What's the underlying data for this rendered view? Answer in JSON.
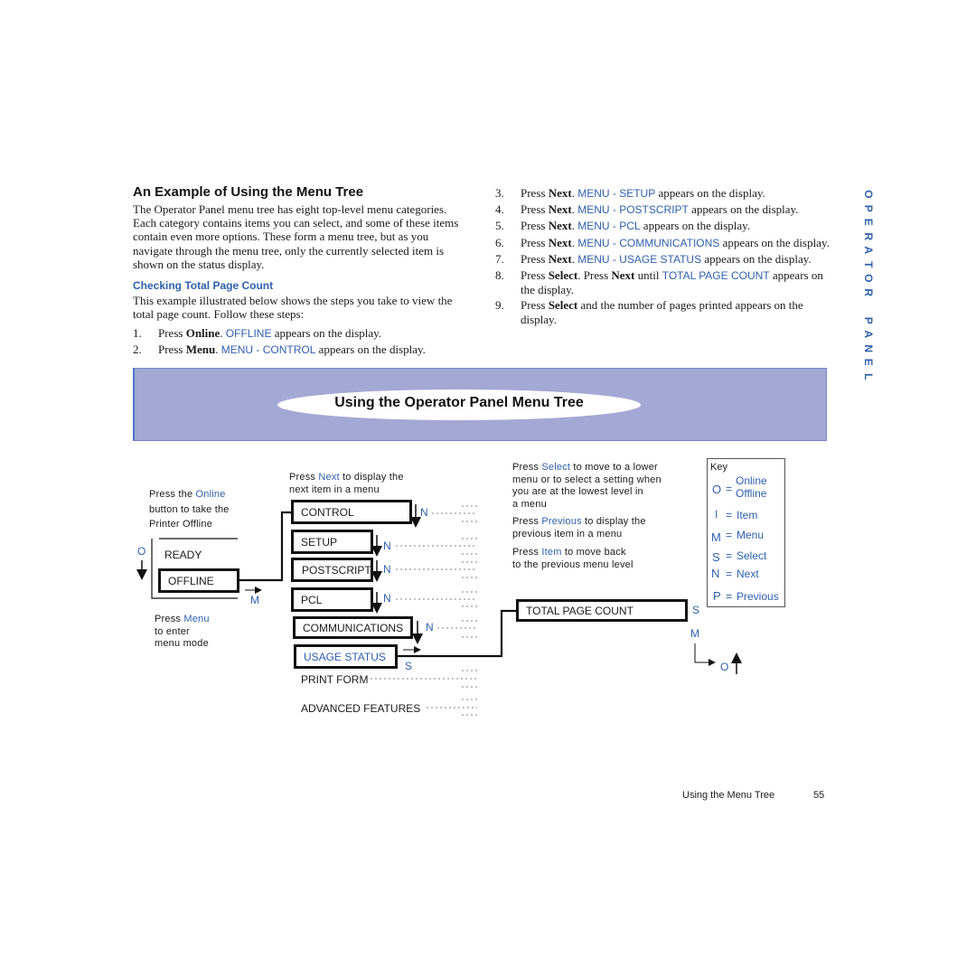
{
  "section": {
    "title": "An Example of Using the Menu Tree",
    "intro": "The Operator Panel menu tree has eight top-level menu categories. Each category contains items you can select, and some of these items contain even more options. These form a menu tree, but as you navigate through the menu tree, only the currently selected item is shown on the status display.",
    "subheading": "Checking Total Page Count",
    "subintro": "This example illustrated below shows the steps you take to view the total page count. Follow these steps:"
  },
  "steps": [
    {
      "num": "1.",
      "pre": "Press ",
      "key": "Online",
      "mid": ". ",
      "display": "OFFLINE",
      "post": " appears on the display."
    },
    {
      "num": "2.",
      "pre": "Press ",
      "key": "Menu",
      "mid": ". ",
      "display": "MENU - CONTROL",
      "post": " appears on the display."
    },
    {
      "num": "3.",
      "pre": "Press ",
      "key": "Next",
      "mid": ". ",
      "display": "MENU - SETUP",
      "post": " appears on the display."
    },
    {
      "num": "4.",
      "pre": "Press ",
      "key": "Next",
      "mid": ". ",
      "display": "MENU - POSTSCRIPT",
      "post": " appears on the display."
    },
    {
      "num": "5.",
      "pre": "Press ",
      "key": "Next",
      "mid": ". ",
      "display": "MENU - PCL",
      "post": " appears on the display."
    },
    {
      "num": "6.",
      "pre": "Press ",
      "key": "Next",
      "mid": ". ",
      "display": "MENU - COMMUNICATIONS",
      "post": " appears on the display."
    },
    {
      "num": "7.",
      "pre": "Press ",
      "key": "Next",
      "mid": ". ",
      "display": "MENU - USAGE STATUS",
      "post": " appears on the display."
    },
    {
      "num": "8.",
      "pre": "Press ",
      "key": "Select",
      "mid": ". Press ",
      "key2": "Next",
      "mid2": " until ",
      "display": "TOTAL PAGE COUNT",
      "post": " appears on the display."
    },
    {
      "num": "9.",
      "pre": "Press ",
      "key": "Select",
      "post": " and the number of pages printed appears on the display."
    }
  ],
  "side_tab": "OPERATOR PANEL",
  "band_title": "Using the Operator Panel Menu Tree",
  "diagram": {
    "online_note": {
      "pre": "Press the ",
      "key": "Online",
      "line2": "button to take the",
      "line3": "Printer Offline"
    },
    "menu_note": {
      "pre": "Press ",
      "key": "Menu",
      "line2": "to enter",
      "line3": "menu mode"
    },
    "next_note": {
      "pre": "Press ",
      "key": "Next",
      "post": " to display the",
      "line2": "next item in a menu"
    },
    "select_note": {
      "pre": "Press ",
      "key": "Select",
      "post": " to move to a lower",
      "line2": "menu or to select a setting when",
      "line3": "you are at the lowest level in",
      "line4": "a menu"
    },
    "previous_note": {
      "pre": "Press ",
      "key": "Previous",
      "post": " to display the",
      "line2": "previous item in a menu"
    },
    "item_note": {
      "pre": "Press ",
      "key": "Item",
      "post": " to move back",
      "line2": "to the previous menu level"
    },
    "display_states": [
      "READY",
      "OFFLINE"
    ],
    "menus": [
      "CONTROL",
      "SETUP",
      "POSTSCRIPT",
      "PCL",
      "COMMUNICATIONS",
      "USAGE STATUS",
      "PRINT FORM",
      "ADVANCED FEATURES"
    ],
    "selected_menu": "USAGE STATUS",
    "submenu_item": "TOTAL PAGE COUNT",
    "key_letters": {
      "O": "O",
      "M": "M",
      "N": "N",
      "S": "S"
    }
  },
  "key": {
    "title": "Key",
    "entries": [
      {
        "letter": "O",
        "eq": "=",
        "meaning": "Online",
        "meaning2": "Offline"
      },
      {
        "letter": "I",
        "eq": "=",
        "meaning": "Item"
      },
      {
        "letter": "M",
        "eq": "=",
        "meaning": "Menu"
      },
      {
        "letter": "S",
        "eq": "=",
        "meaning": "Select"
      },
      {
        "letter": "N",
        "eq": "=",
        "meaning": "Next"
      },
      {
        "letter": "P",
        "eq": "=",
        "meaning": "Previous"
      }
    ]
  },
  "footer": {
    "title": "Using the Menu Tree",
    "page": "55"
  },
  "colors": {
    "accent": "#2f5fae",
    "band": "#a3a8d4",
    "band_border": "#4a73c6"
  }
}
